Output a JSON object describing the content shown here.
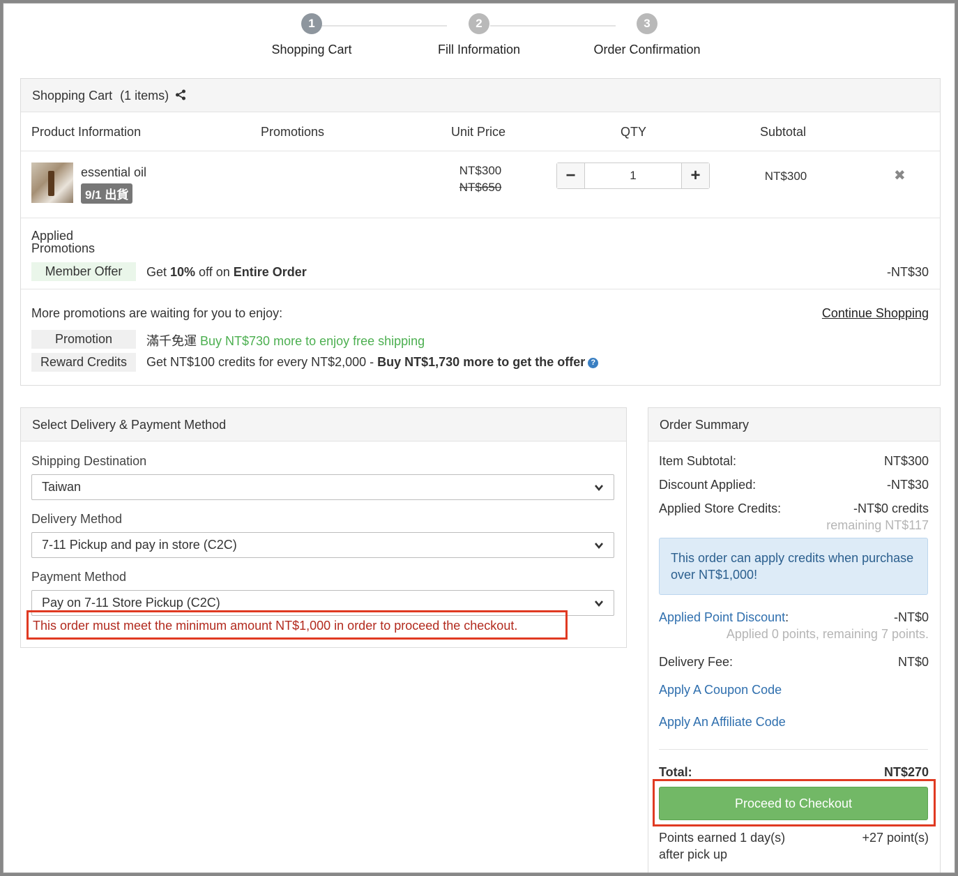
{
  "steps": [
    {
      "num": "1",
      "label": "Shopping Cart"
    },
    {
      "num": "2",
      "label": "Fill Information"
    },
    {
      "num": "3",
      "label": "Order Confirmation"
    }
  ],
  "cart": {
    "title": "Shopping Cart",
    "count_text": "(1 items)",
    "columns": {
      "product": "Product Information",
      "promotions": "Promotions",
      "unit_price": "Unit Price",
      "qty": "QTY",
      "subtotal": "Subtotal"
    },
    "item": {
      "name": "essential oil",
      "badge": "9/1 出貨",
      "price": "NT$300",
      "original_price": "NT$650",
      "qty": "1",
      "minus": "−",
      "plus": "+",
      "subtotal": "NT$300",
      "remove": "✖"
    },
    "applied_title": "Applied Promotions",
    "applied": {
      "tag": "Member Offer",
      "text_pre": "Get ",
      "text_bold1": "10%",
      "text_mid": " off on ",
      "text_bold2": "Entire Order",
      "amount": "-NT$30"
    },
    "more_title": "More promotions are waiting for you to enjoy:",
    "continue_link": "Continue Shopping",
    "promotion": {
      "tag": "Promotion",
      "text_plain": "滿千免運 ",
      "text_green": "Buy NT$730 more to enjoy free shipping"
    },
    "reward": {
      "tag": "Reward Credits",
      "text_plain": "Get NT$100 credits for every NT$2,000 - ",
      "text_bold": "Buy NT$1,730 more to get the offer",
      "help": "?"
    }
  },
  "delivery": {
    "title": "Select Delivery & Payment Method",
    "shipping_label": "Shipping Destination",
    "shipping_value": "Taiwan",
    "method_label": "Delivery Method",
    "method_value": "7-11 Pickup and pay in store (C2C)",
    "payment_label": "Payment Method",
    "payment_value": "Pay on 7-11 Store Pickup (C2C)",
    "error": "This order must meet the minimum amount NT$1,000 in order to proceed the checkout."
  },
  "summary": {
    "title": "Order Summary",
    "item_subtotal_label": "Item Subtotal:",
    "item_subtotal": "NT$300",
    "discount_label": "Discount Applied:",
    "discount": "-NT$30",
    "credits_label": "Applied Store Credits:",
    "credits": "-NT$0 credits",
    "credits_remaining": "remaining NT$117",
    "info": "This order can apply credits when purchase over NT$1,000!",
    "point_label": "Applied Point Discount",
    "point_colon": ":",
    "point_value": "-NT$0",
    "point_note": "Applied 0 points, remaining 7 points.",
    "delivery_label": "Delivery Fee:",
    "delivery_fee": "NT$0",
    "coupon_link": "Apply A Coupon Code",
    "affiliate_link": "Apply An Affiliate Code",
    "total_label": "Total:",
    "total": "NT$270",
    "checkout_button": "Proceed to Checkout",
    "points_earned_label": "Points earned 1 day(s) after pick up",
    "points_earned": "+27 point(s)"
  }
}
